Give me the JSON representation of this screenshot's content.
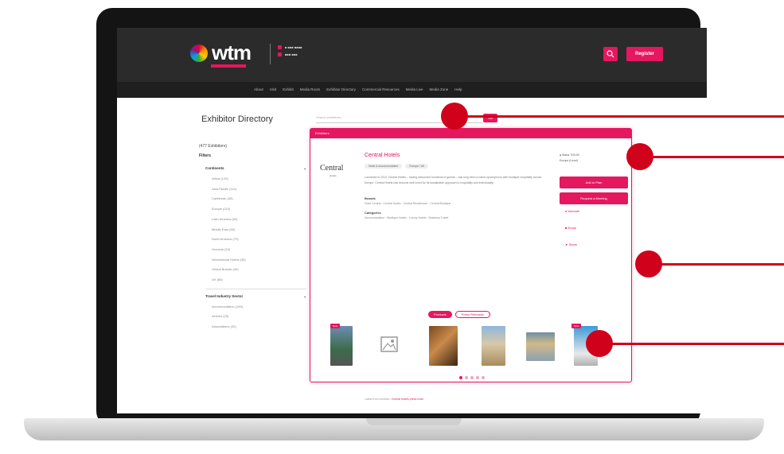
{
  "header": {
    "logo_text": "wtm",
    "event_line1": "■ ■■■ ■■■■",
    "event_line2": "■■■ ■■■",
    "search_icon": "search-icon",
    "register_label": "Register"
  },
  "nav": {
    "items": [
      "About",
      "Visit",
      "Exhibit",
      "Media Room",
      "Exhibitor Directory",
      "Commercial Resources",
      "Media Live",
      "Media Zone",
      "Help"
    ]
  },
  "directory": {
    "title": "Exhibitor Directory",
    "search_placeholder": "Search exhibitors...",
    "search_button": "Go",
    "count_label": "(477 Exhibitors)",
    "filters_label": "Filters"
  },
  "filters": {
    "group1_title": "Continents",
    "group1_items": [
      "Africa (120)",
      "Asia-Pacific (110)",
      "Caribbean (45)",
      "Europe (210)",
      "Latin America (60)",
      "Middle East (55)",
      "North America (70)",
      "Oceania (20)",
      "International Hotels (35)",
      "Global Brands (40)",
      "UK (85)"
    ],
    "group2_title": "Travel Industry Sector",
    "group2_items": [
      "Accommodation (150)",
      "Airlines (25)",
      "Associations (30)"
    ]
  },
  "card": {
    "header_label": "Exhibitors",
    "logo_text": "Central",
    "logo_sub": "Hotels",
    "title": "Central Hotels",
    "tags": [
      "Hotel & Accommodation",
      "Europe / UK"
    ],
    "description": "Launched in 2013, Central Hotels – having welcomed hundreds of guests – has long been a name synonymous with boutique hospitality across Europe. Central Hotels has become well loved for its sustainable approach to hospitality and individuality.",
    "brands_label": "Brands",
    "brands_text": "Hotel Central · Central Suites · Central Residences · Central Boutique",
    "categories_label": "Categories",
    "categories_text": "Accommodation · Boutique Hotels · Luxury Hotels · Business Travel",
    "stand_line1": "Stand: ES100",
    "stand_line2": "Europe (Level)",
    "add_button": "Add to Plan",
    "meeting_button": "Request a Meeting",
    "link1": "Website",
    "link2": "Email",
    "link3": "Share",
    "toggle_on": "Products",
    "toggle_off": "Press Releases",
    "badge_label": "New",
    "footer_prefix": "Latest from exhibitor:",
    "footer_link": "Central Hotels press room"
  },
  "colors": {
    "accent": "#e5175e",
    "callout": "#d0021b",
    "header_bg": "#2b2b2b"
  }
}
